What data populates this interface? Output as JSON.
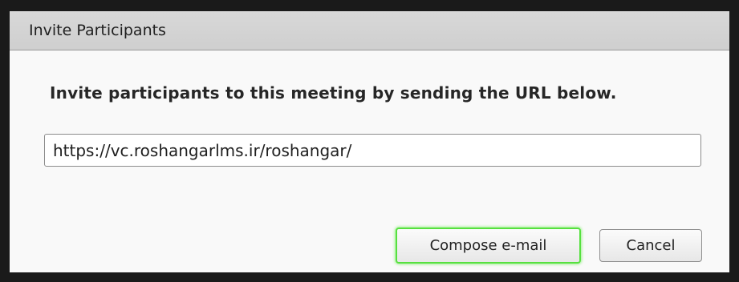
{
  "dialog": {
    "title": "Invite Participants",
    "message": "Invite participants to this meeting by sending the URL below.",
    "url_value": "https://vc.roshangarlms.ir/roshangar/",
    "buttons": {
      "compose_label": "Compose e-mail",
      "cancel_label": "Cancel"
    },
    "colors": {
      "titlebar": "#d3d3d3",
      "body": "#f9f9f9",
      "focus_ring": "#56e03f",
      "frame": "#1a1a1a"
    }
  }
}
